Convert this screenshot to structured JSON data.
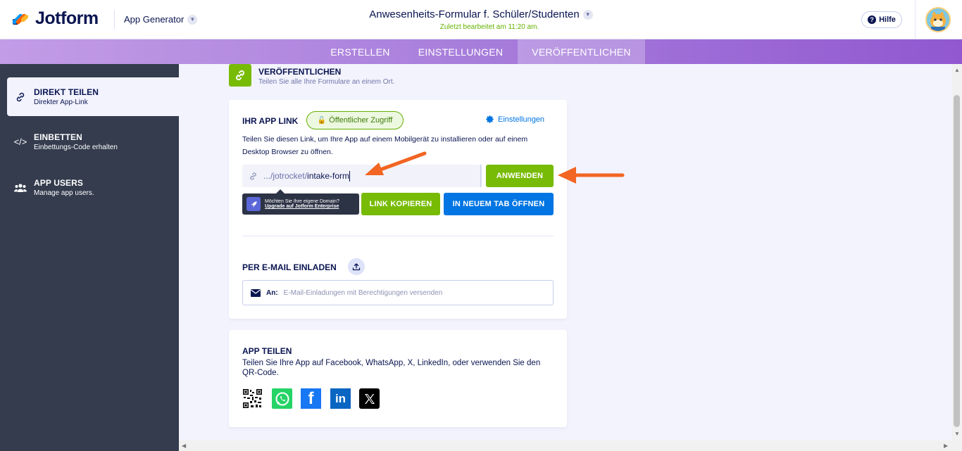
{
  "header": {
    "logo_text": "Jotform",
    "app_generator": "App Generator",
    "doc_title": "Anwesenheits-Formular f. Schüler/Studenten",
    "last_edited": "Zuletzt bearbeitet am 11:20 am.",
    "help_label": "Hilfe"
  },
  "tabs": [
    {
      "label": "ERSTELLEN"
    },
    {
      "label": "EINSTELLUNGEN"
    },
    {
      "label": "VERÖFFENTLICHEN",
      "active": true
    }
  ],
  "sidebar": {
    "items": [
      {
        "title": "DIREKT TEILEN",
        "subtitle": "Direkter App-Link",
        "icon": "link-icon",
        "active": true
      },
      {
        "title": "EINBETTEN",
        "subtitle": "Einbettungs-Code erhalten",
        "icon": "code-icon"
      },
      {
        "title": "APP USERS",
        "subtitle": "Manage app users.",
        "icon": "users-icon"
      }
    ]
  },
  "publish_header": {
    "title": "VERÖFFENTLICHEN",
    "subtitle": "Teilen Sie alle Ihre Formulare an einem Ort."
  },
  "app_link": {
    "title": "IHR APP LINK",
    "badge": "Öffentlicher Zugriff",
    "settings": "Einstellungen",
    "description": "Teilen Sie diesen Link, um Ihre App auf einem Mobilgerät zu installieren oder auf einem Desktop Browser zu öffnen.",
    "link_prefix": ".../jotrocket/",
    "link_value": "intake-form",
    "apply_button": "ANWENDEN",
    "copy_button": "LINK KOPIEREN",
    "open_tab_button": "IN NEUEM TAB ÖFFNEN",
    "tooltip_line1": "Möchten Sie Ihre eigene Domain?",
    "tooltip_line2": "Upgrade auf Jotform Enterprise"
  },
  "email_invite": {
    "title": "PER E-MAIL EINLADEN",
    "to_label": "An:",
    "placeholder": "E-Mail-Einladungen mit Berechtigungen versenden"
  },
  "share_app": {
    "title": "APP TEILEN",
    "description": "Teilen Sie Ihre App auf Facebook, WhatsApp, X, LinkedIn, oder verwenden Sie den QR-Code.",
    "icons": [
      "qr-code-icon",
      "whatsapp-icon",
      "facebook-icon",
      "linkedin-icon",
      "x-icon"
    ]
  },
  "colors": {
    "green": "#78bb07",
    "blue": "#0075e3",
    "sidebar": "#343c4e",
    "annotation_arrow": "#f26522"
  }
}
